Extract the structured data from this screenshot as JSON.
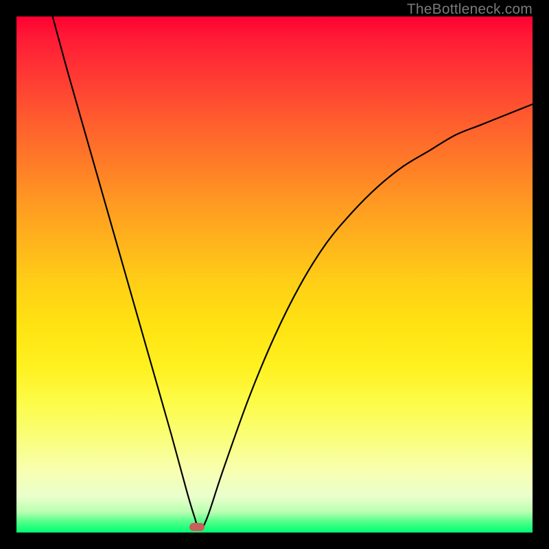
{
  "watermark": "TheBottleneck.com",
  "chart_data": {
    "type": "line",
    "title": "",
    "xlabel": "",
    "ylabel": "",
    "xlim": [
      0,
      100
    ],
    "ylim": [
      0,
      100
    ],
    "grid": false,
    "legend": false,
    "series": [
      {
        "name": "bottleneck-curve",
        "x": [
          7,
          10,
          14,
          18,
          22,
          26,
          30,
          33,
          34.5,
          35.5,
          37,
          40,
          45,
          50,
          55,
          60,
          65,
          70,
          75,
          80,
          85,
          90,
          95,
          100
        ],
        "values": [
          100,
          89,
          75,
          61,
          47,
          33,
          19,
          8,
          3,
          0.5,
          3,
          12,
          26,
          38,
          48,
          56,
          62,
          67,
          71,
          74,
          77,
          79,
          81,
          83
        ]
      }
    ],
    "marker": {
      "x_percent": 35.0,
      "y_from_top_percent": 99.0
    },
    "background_gradient": {
      "top": "#ff0030",
      "mid": "#ffe312",
      "bottom": "#00ff74"
    }
  }
}
